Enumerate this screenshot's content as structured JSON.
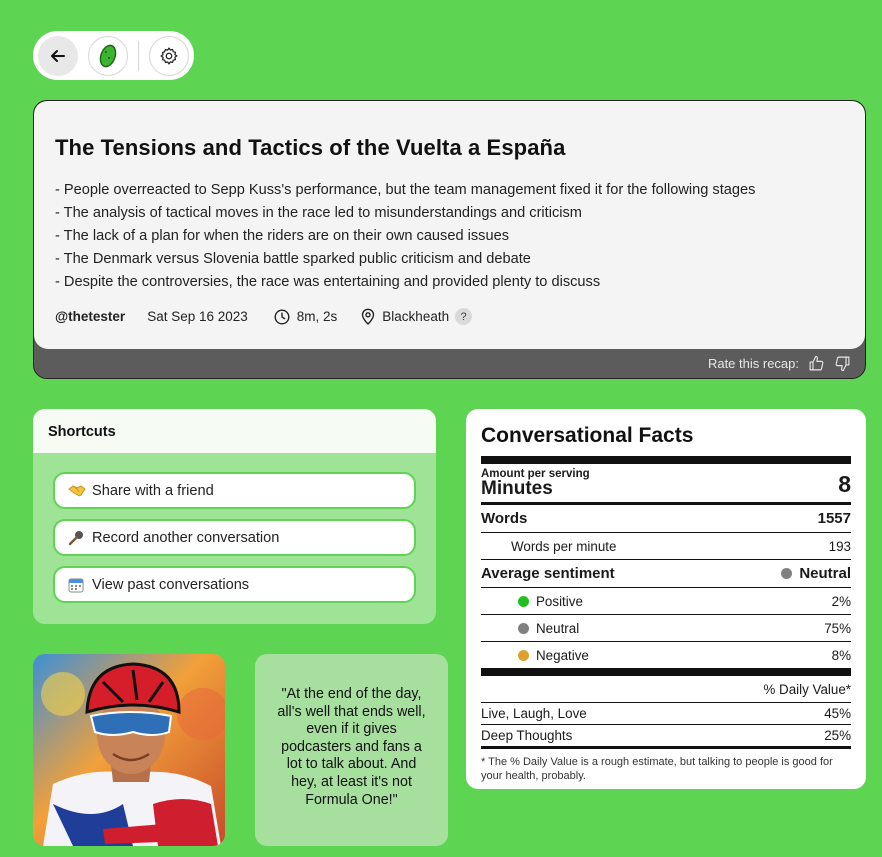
{
  "toolbar": {
    "back_icon": "arrow-left-icon",
    "logo_icon": "pickle-logo-icon",
    "settings_icon": "gear-icon"
  },
  "recap": {
    "title": "The Tensions and Tactics of the Vuelta a España",
    "bullets": [
      "- People overreacted to Sepp Kuss's performance, but the team management fixed it for the following stages",
      "- The analysis of tactical moves in the race led to misunderstandings and criticism",
      "- The lack of a plan for when the riders are on their own caused issues",
      "- The Denmark versus Slovenia battle sparked public criticism and debate",
      "- Despite the controversies, the race was entertaining and provided plenty to discuss"
    ],
    "user": "@thetester",
    "date": "Sat Sep 16 2023",
    "duration": "8m, 2s",
    "location": "Blackheath",
    "location_help": "?",
    "rate_label": "Rate this recap:"
  },
  "shortcuts": {
    "title": "Shortcuts",
    "items": [
      {
        "icon": "handshake-icon",
        "label": "Share with a friend"
      },
      {
        "icon": "microphone-icon",
        "label": "Record another conversation"
      },
      {
        "icon": "calendar-icon",
        "label": "View past conversations"
      }
    ]
  },
  "quote": "\"At the end of the day, all's well that ends well, even if it gives podcasters and fans a lot to talk about. And hey, at least it's not Formula One!\"",
  "facts": {
    "title": "Conversational Facts",
    "serving_label": "Amount per serving",
    "serving_unit": "Minutes",
    "serving_value": "8",
    "words_label": "Words",
    "words_value": "1557",
    "wpm_label": "Words per minute",
    "wpm_value": "193",
    "sentiment_label": "Average sentiment",
    "sentiment_value": "Neutral",
    "sentiments": [
      {
        "label": "Positive",
        "value": "2%",
        "color": "#22c01e"
      },
      {
        "label": "Neutral",
        "value": "75%",
        "color": "#808080"
      },
      {
        "label": "Negative",
        "value": "8%",
        "color": "#e0a030"
      }
    ],
    "neutral_color": "#808080",
    "dv_header": "% Daily Value*",
    "dv_items": [
      {
        "label": "Live, Laugh, Love",
        "value": "45%"
      },
      {
        "label": "Deep Thoughts",
        "value": "25%"
      }
    ],
    "footnote": "* The % Daily Value is a rough estimate, but talking to people is good for your health, probably."
  }
}
